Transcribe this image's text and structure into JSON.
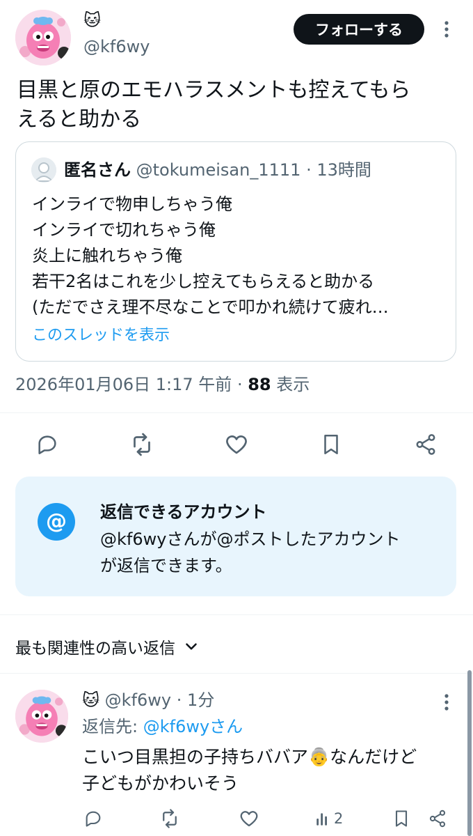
{
  "post": {
    "display_name": "🐱",
    "handle": "@kf6wy",
    "follow_label": "フォローする",
    "text_line1": "目黒と原のエモハラスメントも控えてもら",
    "text_line2": "えると助かる",
    "quote": {
      "name": "匿名さん",
      "handle": "@tokumeisan_1111",
      "sep": "·",
      "time": "13時間",
      "lines": [
        "インライで物申しちゃう俺",
        "インライで切れちゃう俺",
        "炎上に触れちゃう俺",
        "若干2名はこれを少し控えてもらえると助かる",
        "(ただでさえ理不尽なことで叩かれ続けて疲れ…"
      ],
      "show_thread": "このスレッドを表示"
    },
    "timestamp": "2026年01月06日 1:17 午前",
    "views_sep": "·",
    "views_count": "88",
    "views_label": "表示"
  },
  "reply_notice": {
    "title": "返信できるアカウント",
    "line1": "@kf6wyさんが@ポストしたアカウント",
    "line2": "が返信できます。"
  },
  "sort": {
    "label": "最も関連性の高い返信"
  },
  "reply": {
    "name": "🐱",
    "handle": "@kf6wy",
    "sep": "·",
    "time": "1分",
    "reply_to_prefix": "返信先: ",
    "reply_to_handle": "@kf6wyさん",
    "line1": "こいつ目黒担の子持ちババア👵なんだけど",
    "line2": "子どもがかわいそう",
    "views": "2"
  },
  "colors": {
    "accent": "#1d9bf0",
    "muted": "#536471",
    "notice_bg": "#e8f5fd",
    "follow_bg": "#0f1419"
  }
}
